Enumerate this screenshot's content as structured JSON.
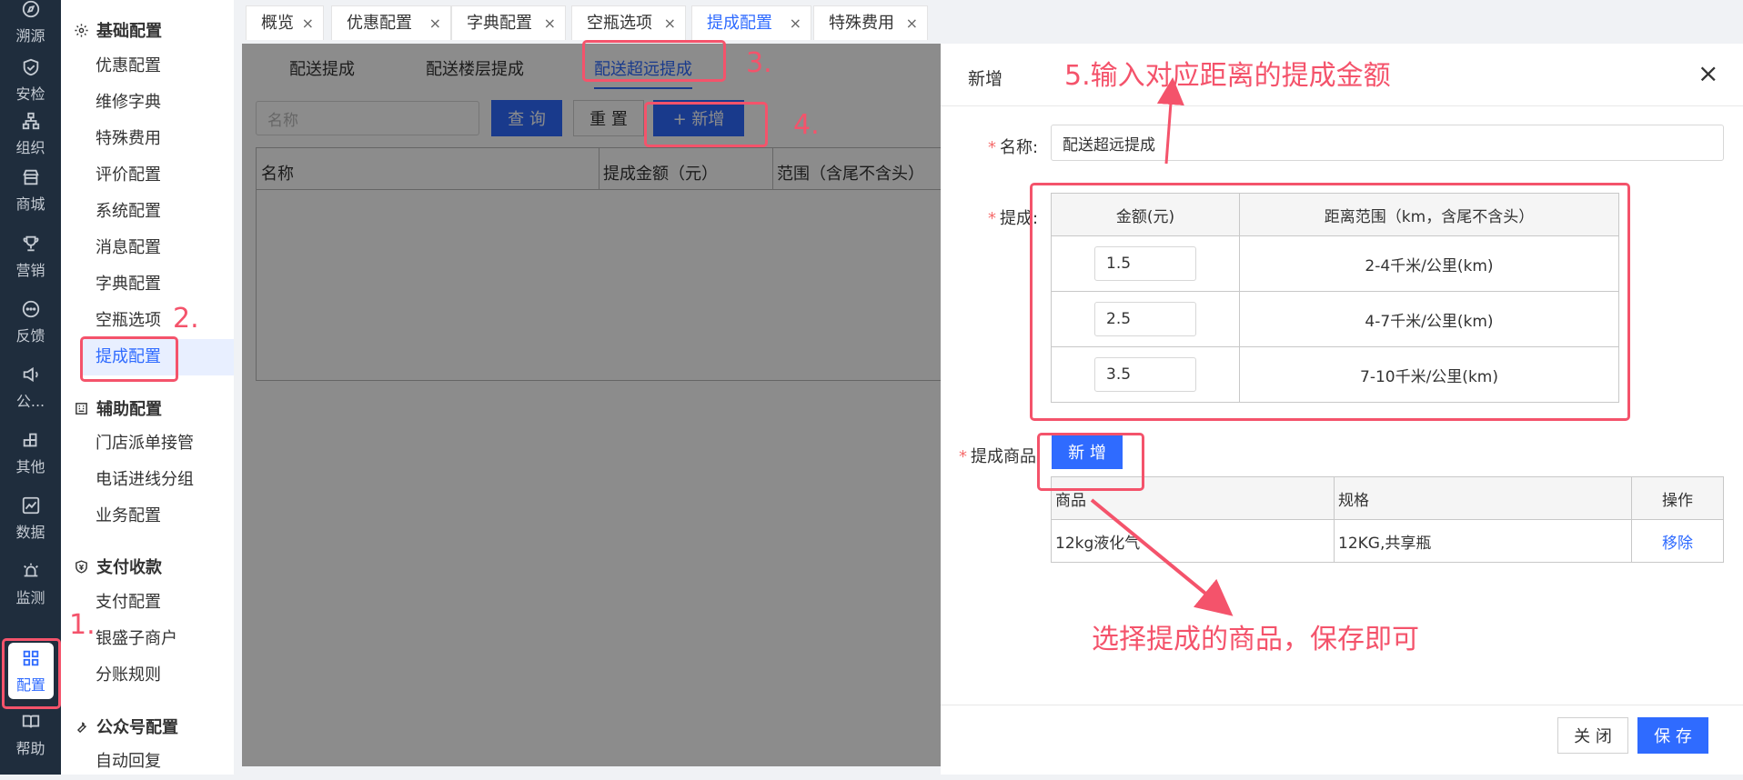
{
  "rail": {
    "items": [
      "溯源",
      "安检",
      "组织",
      "商城",
      "营销",
      "反馈",
      "公...",
      "其他",
      "数据",
      "监测",
      "配置",
      "帮助"
    ],
    "icons": [
      "compass-icon",
      "shield-check-icon",
      "org-chart-icon",
      "store-icon",
      "trophy-icon",
      "chat-icon",
      "speaker-icon",
      "grid-plus-icon",
      "line-chart-icon",
      "alarm-icon",
      "apps-icon",
      "book-icon"
    ]
  },
  "menu": {
    "groups": [
      "基础配置",
      "辅助配置",
      "支付收款",
      "公众号配置"
    ],
    "basic": [
      "优惠配置",
      "维修字典",
      "特殊费用",
      "评价配置",
      "系统配置",
      "消息配置",
      "字典配置",
      "空瓶选项",
      "提成配置"
    ],
    "aux": [
      "门店派单接管",
      "电话进线分组",
      "业务配置"
    ],
    "pay": [
      "支付配置",
      "银盛子商户",
      "分账规则"
    ],
    "wx": [
      "自动回复"
    ]
  },
  "tabs": [
    "概览",
    "优惠配置",
    "字典配置",
    "空瓶选项",
    "提成配置",
    "特殊费用"
  ],
  "subtabs": [
    "配送提成",
    "配送楼层提成",
    "配送超远提成"
  ],
  "toolbar": {
    "name_placeholder": "名称",
    "query": "查 询",
    "reset": "重 置",
    "add": "+ 新增"
  },
  "list_headers": [
    "名称",
    "提成金额（元）",
    "范围（含尾不含头）"
  ],
  "drawer": {
    "title": "新增",
    "close_x": "×",
    "name_label": "名称:",
    "name_value": "配送超远提成",
    "commission_label": "提成:",
    "commission_headers": [
      "金额(元)",
      "距离范围（km，含尾不含头）"
    ],
    "commission_rows": [
      {
        "amount": "1.5",
        "range": "2-4千米/公里(km)"
      },
      {
        "amount": "2.5",
        "range": "4-7千米/公里(km)"
      },
      {
        "amount": "3.5",
        "range": "7-10千米/公里(km)"
      }
    ],
    "goods_label": "提成商品:",
    "goods_add": "新 增",
    "goods_headers": [
      "商品",
      "规格",
      "操作"
    ],
    "goods_rows": [
      {
        "name": "12kg液化气",
        "spec": "12KG,共享瓶",
        "action": "移除"
      }
    ],
    "close_btn": "关 闭",
    "save_btn": "保 存"
  },
  "annotations": {
    "n1": "1.",
    "n2": "2.",
    "n3": "3.",
    "n4": "4.",
    "n5": "5.输入对应距离的提成金额",
    "goods_tip": "选择提成的商品，保存即可"
  },
  "colors": {
    "accent": "#2f6bff",
    "annotation": "#f4536b",
    "rail": "#1f2d3d"
  }
}
